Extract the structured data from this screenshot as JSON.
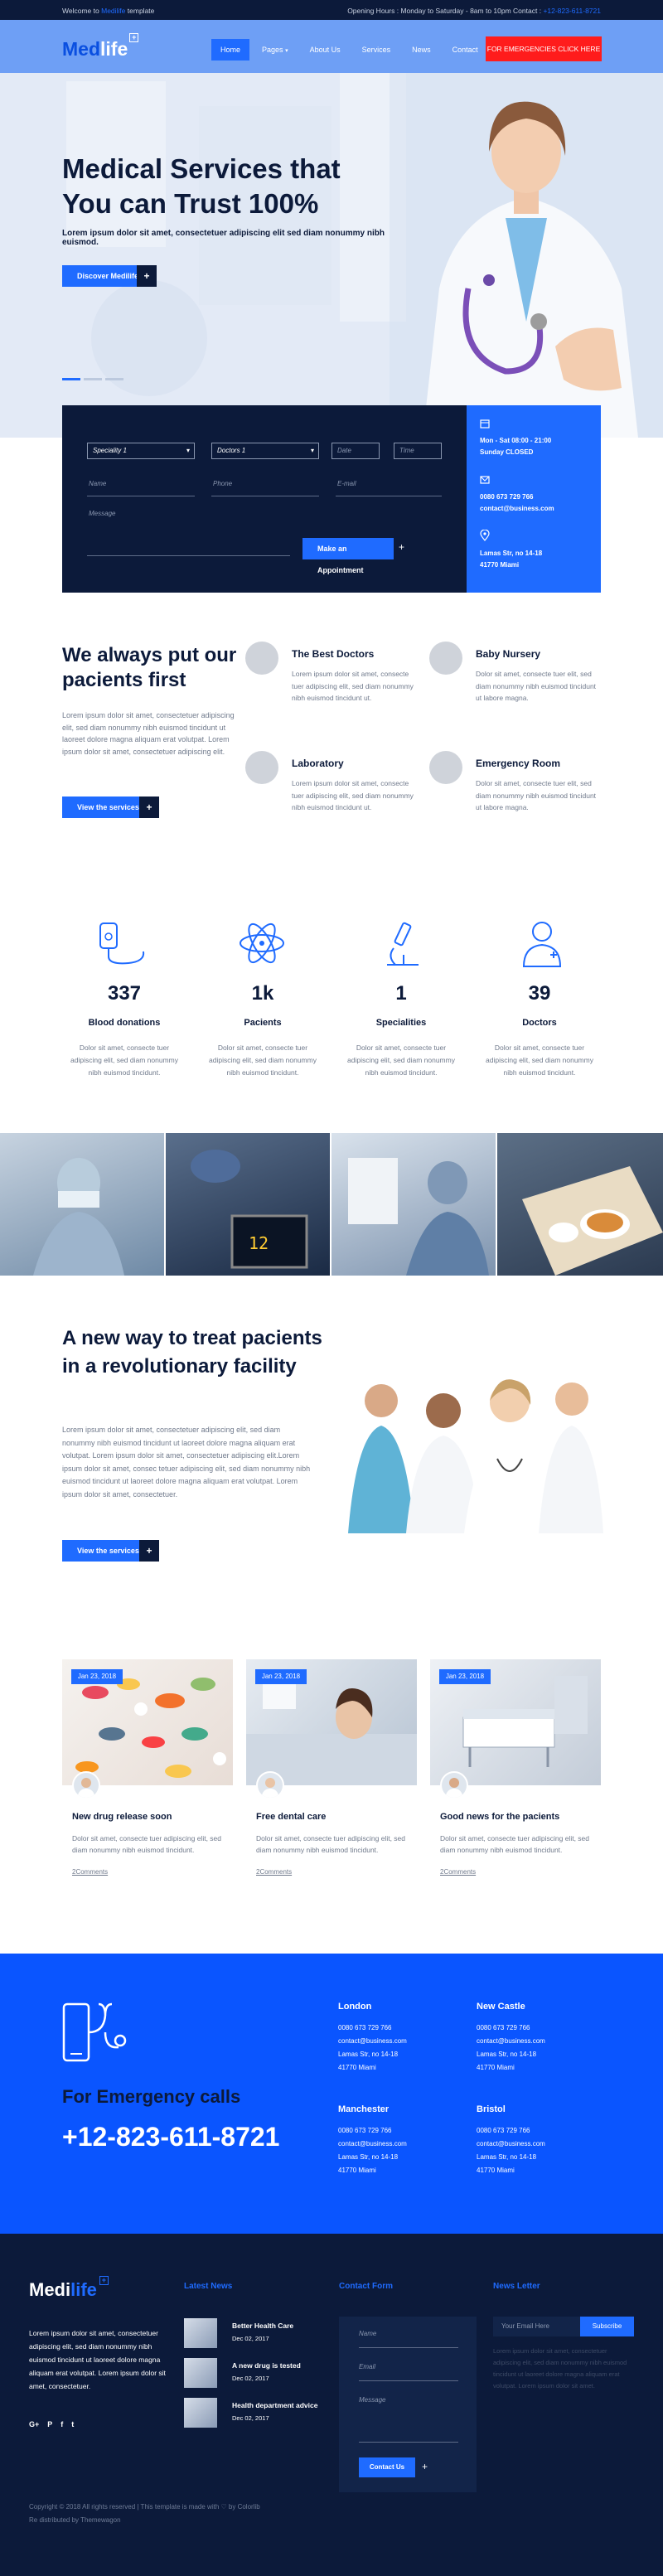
{
  "topbar": {
    "welcome_prefix": "Welcome to",
    "welcome_brand": "Medilife",
    "welcome_suffix": "template",
    "hours": "Opening Hours : Monday to Saturday - 8am to 10pm Contact :",
    "phone": "+12-823-611-8721"
  },
  "header": {
    "logo_main": "Med",
    "logo_accent": "life",
    "logo_badge": "+",
    "nav": [
      "Home",
      "Pages",
      "About Us",
      "Services",
      "News",
      "Contact"
    ],
    "nav_dropdown_icon": "chevron-down-icon",
    "emergency_button": "FOR EMERGENCIES CLICK HERE"
  },
  "hero": {
    "title": "Medical Services that You can Trust 100%",
    "subtitle": "Lorem ipsum dolor sit amet, consectetuer adipiscing elit sed diam nonummy nibh euismod.",
    "button": "Discover Medilife",
    "button_icon": "+",
    "slides": 3,
    "active_slide": 1
  },
  "appointment": {
    "speciality_select": "Speciality 1",
    "doctor_select": "Doctors 1",
    "date_placeholder": "Date",
    "time_placeholder": "Time",
    "name_placeholder": "Name",
    "phone_placeholder": "Phone",
    "email_placeholder": "E-mail",
    "message_placeholder": "Message",
    "submit": "Make an Appointment",
    "submit_icon": "+",
    "info": {
      "hours_line1": "Mon - Sat 08:00 - 21:00",
      "hours_line2": "Sunday CLOSED",
      "phone": "0080 673 729 766",
      "email": "contact@business.com",
      "address_line1": "Lamas Str, no 14-18",
      "address_line2": "41770 Miami"
    }
  },
  "about": {
    "title": "We always put our pacients first",
    "text": "Lorem ipsum dolor sit amet, consectetuer adipiscing elit, sed diam nonummy nibh euismod tincidunt ut laoreet dolore magna aliquam erat volutpat. Lorem ipsum dolor sit amet, consectetuer adipiscing elit.",
    "button": "View the services",
    "button_icon": "+",
    "services": [
      {
        "title": "The Best Doctors",
        "text": "Lorem ipsum dolor sit amet, consecte tuer adipiscing elit, sed diam nonummy nibh euismod tincidunt ut."
      },
      {
        "title": "Baby Nursery",
        "text": "Dolor sit amet, consecte tuer elit, sed diam nonummy nibh euismod tincidunt ut labore magna."
      },
      {
        "title": "Laboratory",
        "text": "Lorem ipsum dolor sit amet, consecte tuer adipiscing elit, sed diam nonummy nibh euismod tincidunt ut."
      },
      {
        "title": "Emergency Room",
        "text": "Dolor sit amet, consecte tuer elit, sed diam nonummy nibh euismod tincidunt ut labore magna."
      }
    ]
  },
  "stats": [
    {
      "number": "337",
      "label": "Blood donations",
      "icon": "blood-bag-icon",
      "text": "Dolor sit amet, consecte tuer adipiscing elit, sed diam nonummy nibh euismod tincidunt."
    },
    {
      "number": "1k",
      "label": "Pacients",
      "icon": "atom-icon",
      "text": "Dolor sit amet, consecte tuer adipiscing elit, sed diam nonummy nibh euismod tincidunt."
    },
    {
      "number": "1",
      "label": "Specialities",
      "icon": "microscope-icon",
      "text": "Dolor sit amet, consecte tuer adipiscing elit, sed diam nonummy nibh euismod tincidunt."
    },
    {
      "number": "39",
      "label": "Doctors",
      "icon": "doctor-icon",
      "text": "Dolor sit amet, consecte tuer adipiscing elit, sed diam nonummy nibh euismod tincidunt."
    }
  ],
  "feature": {
    "title": "A new way to treat pacients in a revolutionary facility",
    "text": "Lorem ipsum dolor sit amet, consectetuer adipiscing elit, sed diam nonummy nibh euismod tincidunt ut laoreet dolore magna aliquam erat volutpat. Lorem ipsum dolor sit amet, consectetuer adipiscing elit.Lorem ipsum dolor sit amet, consec tetuer adipiscing elit, sed diam nonummy nibh euismod tincidunt ut laoreet dolore magna aliquam erat volutpat. Lorem ipsum dolor sit amet, consectetuer.",
    "button": "View the services",
    "button_icon": "+"
  },
  "news": [
    {
      "date": "Jan 23, 2018",
      "title": "New drug release soon",
      "text": "Dolor sit amet, consecte tuer adipiscing elit, sed diam nonummy nibh euismod tincidunt.",
      "comments": "2Comments"
    },
    {
      "date": "Jan 23, 2018",
      "title": "Free dental care",
      "text": "Dolor sit amet, consecte tuer adipiscing elit, sed diam nonummy nibh euismod tincidunt.",
      "comments": "2Comments"
    },
    {
      "date": "Jan 23, 2018",
      "title": "Good news for the pacients",
      "text": "Dolor sit amet, consecte tuer adipiscing elit, sed diam nonummy nibh euismod tincidunt.",
      "comments": "2Comments"
    }
  ],
  "emergency": {
    "label": "For Emergency calls",
    "phone": "+12-823-611-8721",
    "offices": [
      {
        "city": "London",
        "phone": "0080 673 729 766",
        "email": "contact@business.com",
        "street": "Lamas Str, no 14-18",
        "zip": "41770 Miami"
      },
      {
        "city": "New Castle",
        "phone": "0080 673 729 766",
        "email": "contact@business.com",
        "street": "Lamas Str, no 14-18",
        "zip": "41770 Miami"
      },
      {
        "city": "Manchester",
        "phone": "0080 673 729 766",
        "email": "contact@business.com",
        "street": "Lamas Str, no 14-18",
        "zip": "41770 Miami"
      },
      {
        "city": "Bristol",
        "phone": "0080 673 729 766",
        "email": "contact@business.com",
        "street": "Lamas Str, no 14-18",
        "zip": "41770 Miami"
      }
    ]
  },
  "footer": {
    "logo_main": "Medi",
    "logo_accent": "life",
    "logo_badge": "+",
    "about": "Lorem ipsum dolor sit amet, consectetuer adipiscing elit, sed diam nonummy nibh euismod tincidunt ut laoreet dolore magna aliquam erat volutpat. Lorem ipsum dolor sit amet, consectetuer.",
    "social": [
      "G+",
      "P",
      "f",
      "t"
    ],
    "latest_news_heading": "Latest News",
    "latest_news": [
      {
        "title": "Better Health Care",
        "date": "Dec 02, 2017"
      },
      {
        "title": "A new drug is tested",
        "date": "Dec 02, 2017"
      },
      {
        "title": "Health department advice",
        "date": "Dec 02, 2017"
      }
    ],
    "contact_heading": "Contact Form",
    "contact_name_placeholder": "Name",
    "contact_email_placeholder": "Email",
    "contact_message_placeholder": "Message",
    "contact_button": "Contact Us",
    "contact_button_icon": "+",
    "newsletter_heading": "News Letter",
    "newsletter_placeholder": "Your Email Here",
    "newsletter_button": "Subscribe",
    "newsletter_text": "Lorem ipsum dolor sit amet, consectetuer adipiscing elit, sed diam nonummy nibh euismod tincidunt ut laoreet dolore magna aliquam erat volutpat. Lorem ipsum dolor sit amet.",
    "copyright_prefix": "Copyright © 2018 All rights reserved | This template is made with",
    "copyright_heart": "♡",
    "copyright_suffix": "by Colorlib",
    "distributed": "Re distributed by Themewagon"
  },
  "colors": {
    "primary": "#1f6bff",
    "navy": "#0c1a3a",
    "emergency_red": "#ff1c1c",
    "emergency_band": "#0a55ff"
  }
}
